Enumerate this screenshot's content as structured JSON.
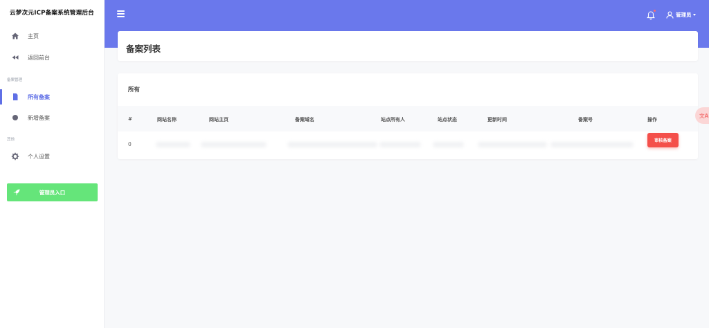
{
  "sidebar": {
    "brand": "云梦次元ICP备案系统管理后台",
    "items": [
      {
        "label": "主页",
        "icon": "home-icon"
      },
      {
        "label": "返回前台",
        "icon": "backward-icon"
      },
      {
        "label": "所有备案",
        "icon": "file-icon"
      },
      {
        "label": "新增备案",
        "icon": "circle-icon"
      },
      {
        "label": "个人设置",
        "icon": "gear-icon"
      }
    ],
    "sections": {
      "filing": "备案管理",
      "other": "其他"
    },
    "admin_button": "管理员入口"
  },
  "header": {
    "user_label": "管理员",
    "accent": "#6a78ec"
  },
  "page": {
    "title": "备案列表"
  },
  "list": {
    "card_title": "所有",
    "columns": [
      "#",
      "网站名称",
      "网站主页",
      "备案域名",
      "站点所有人",
      "站点状态",
      "更新时间",
      "备案号",
      "操作"
    ],
    "rows": [
      {
        "index": "0",
        "action": "审核备案"
      }
    ]
  },
  "translate_badge": "文A"
}
